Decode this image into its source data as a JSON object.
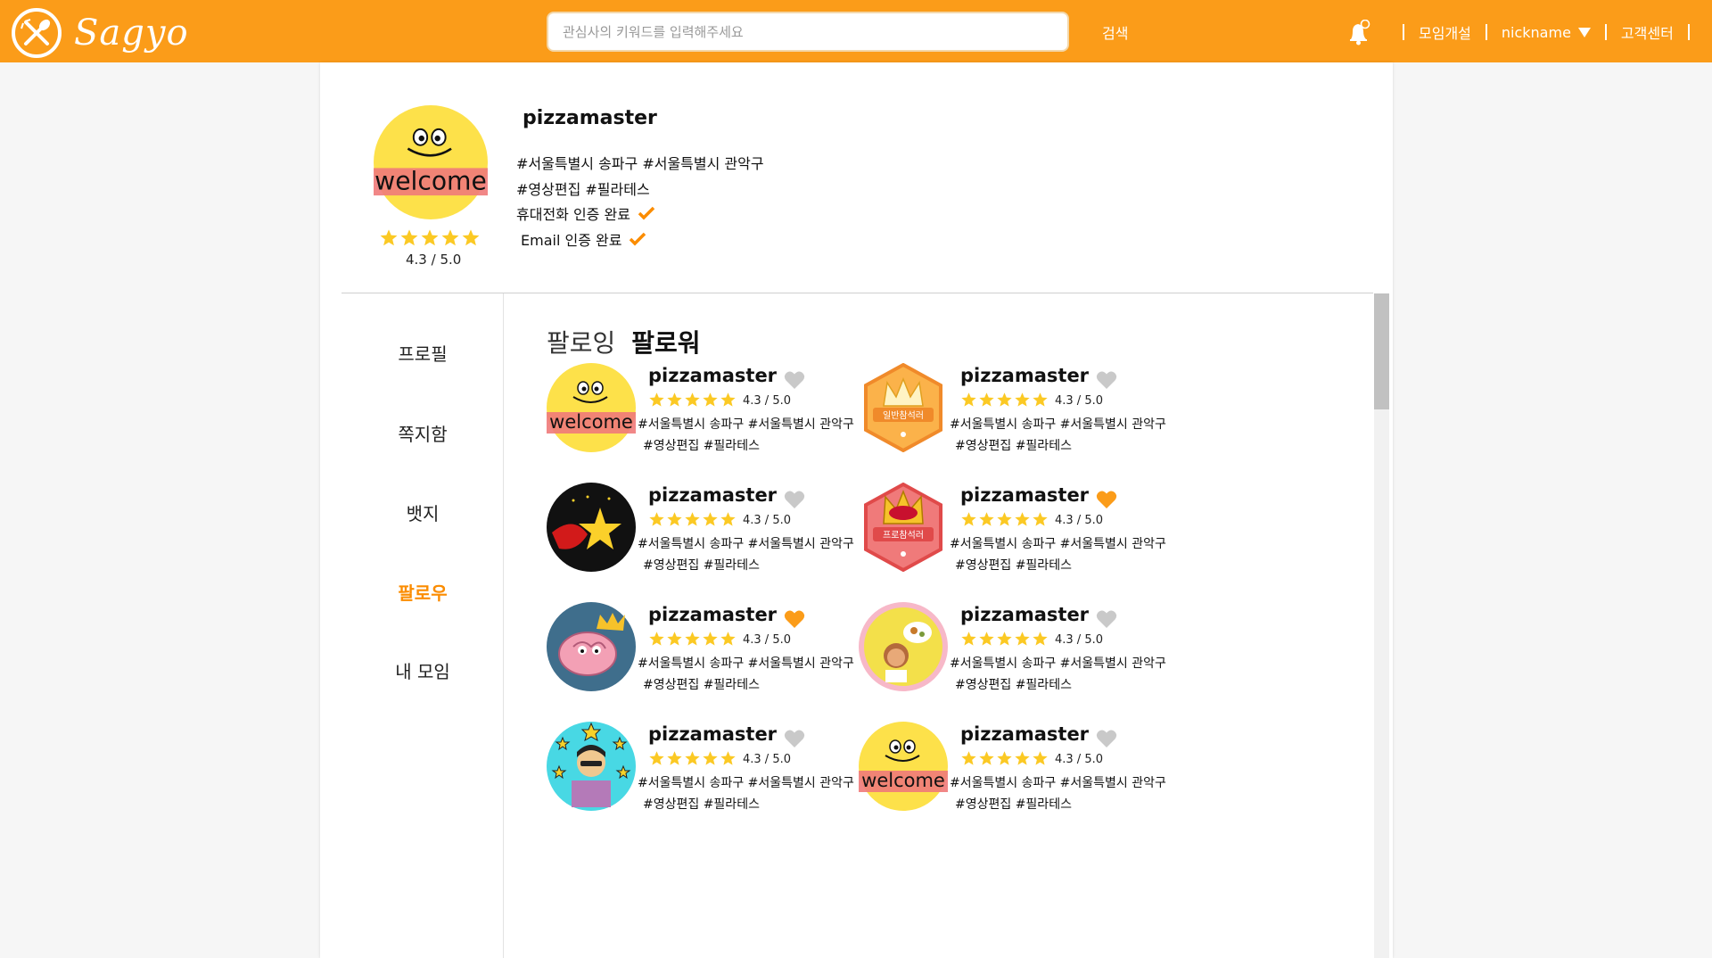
{
  "header": {
    "logo_text": "Sagyo",
    "search_placeholder": "관심사의 키워드를 입력해주세요",
    "search_button": "검색",
    "nav": {
      "create_group": "모임개설",
      "nickname": "nickname",
      "support": "고객센터"
    }
  },
  "profile": {
    "name": "pizzamaster",
    "avatar_text": "welcome",
    "rating": "4.3 / 5.0",
    "locations": "#서울특별시 송파구  #서울특별시 관악구",
    "interests": "#영상편집 #필라테스",
    "phone_verified": "휴대전화 인증 완료",
    "email_verified": "Email 인증 완료"
  },
  "sidebar": {
    "items": [
      {
        "label": "프로필"
      },
      {
        "label": "쪽지함"
      },
      {
        "label": "뱃지"
      },
      {
        "label": "팔로우"
      },
      {
        "label": "내 모임"
      }
    ],
    "active": "팔로우"
  },
  "tabs": {
    "following": "팔로잉",
    "followers": "팔로워"
  },
  "users": [
    {
      "name": "pizzamaster",
      "rating": "4.3 / 5.0",
      "tags1": "#서울특별시 송파구  #서울특별시 관악구",
      "tags2": "#영상편집 #필라테스",
      "liked": false,
      "avatar": "welcome-smiley",
      "avatar_text": "welcome"
    },
    {
      "name": "pizzamaster",
      "rating": "4.3 / 5.0",
      "tags1": "#서울특별시 송파구  #서울특별시 관악구",
      "tags2": "#영상편집 #필라테스",
      "liked": false,
      "avatar": "crown-badge-general",
      "avatar_text": "일반참석러"
    },
    {
      "name": "pizzamaster",
      "rating": "4.3 / 5.0",
      "tags1": "#서울특별시 송파구  #서울특별시 관악구",
      "tags2": "#영상편집 #필라테스",
      "liked": false,
      "avatar": "star-hero"
    },
    {
      "name": "pizzamaster",
      "rating": "4.3 / 5.0",
      "tags1": "#서울특별시 송파구  #서울특별시 관악구",
      "tags2": "#영상편집 #필라테스",
      "liked": true,
      "avatar": "crown-badge-pro",
      "avatar_text": "프로참석러"
    },
    {
      "name": "pizzamaster",
      "rating": "4.3 / 5.0",
      "tags1": "#서울특별시 송파구  #서울특별시 관악구",
      "tags2": "#영상편집 #필라테스",
      "liked": true,
      "avatar": "brain-crown"
    },
    {
      "name": "pizzamaster",
      "rating": "4.3 / 5.0",
      "tags1": "#서울특별시 송파구  #서울특별시 관악구",
      "tags2": "#영상편집 #필라테스",
      "liked": false,
      "avatar": "girl-food"
    },
    {
      "name": "pizzamaster",
      "rating": "4.3 / 5.0",
      "tags1": "#서울특별시 송파구  #서울특별시 관악구",
      "tags2": "#영상편집 #필라테스",
      "liked": false,
      "avatar": "star-man"
    },
    {
      "name": "pizzamaster",
      "rating": "4.3 / 5.0",
      "tags1": "#서울특별시 송파구  #서울특별시 관악구",
      "tags2": "#영상편집 #필라테스",
      "liked": false,
      "avatar": "welcome-smiley",
      "avatar_text": "welcome"
    }
  ],
  "colors": {
    "brand": "#fb9c19",
    "active": "#fb8c00",
    "heart_on": "#fb9c19",
    "heart_off": "#c9c9c9",
    "star": "#fbc924"
  }
}
